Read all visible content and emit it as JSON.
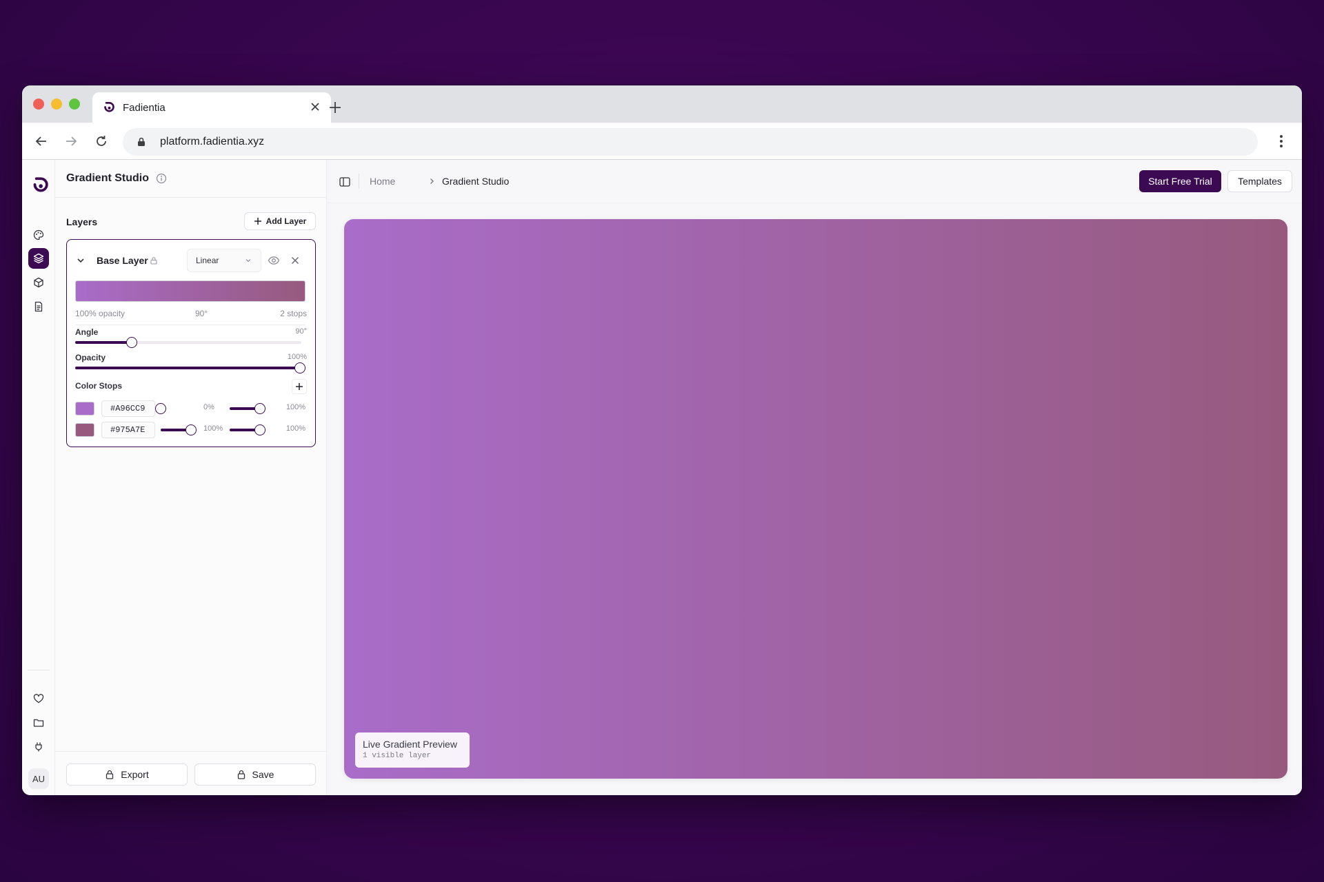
{
  "browser": {
    "tab_title": "Fadientia",
    "url": "platform.fadientia.xyz"
  },
  "app": {
    "panel_title": "Gradient Studio",
    "avatar_initials": "AU",
    "rail_icons": [
      "palette-icon",
      "layers-icon",
      "cube-icon",
      "document-icon",
      "heart-icon",
      "folder-icon",
      "plug-icon"
    ],
    "active_rail_icon": "layers-icon",
    "accent_color": "#3b0a52"
  },
  "layers": {
    "label": "Layers",
    "add_label": "Add Layer"
  },
  "layer": {
    "name": "Base Layer",
    "type": "Linear",
    "opacity_text": "100% opacity",
    "angle_text": "90°",
    "stops_text": "2 stops",
    "angle_label": "Angle",
    "angle_value": "90°",
    "angle_fraction": 0.25,
    "opacity_label": "Opacity",
    "opacity_value": "100%",
    "opacity_fraction": 1.0,
    "stops_label": "Color Stops",
    "stops": [
      {
        "color": "#A96CC9",
        "hex": "#A96CC9",
        "position": "0%",
        "position_fraction": 0.0,
        "alpha": "100%",
        "alpha_fraction": 1.0
      },
      {
        "color": "#975A7E",
        "hex": "#975A7E",
        "position": "100%",
        "position_fraction": 1.0,
        "alpha": "100%",
        "alpha_fraction": 1.0
      }
    ]
  },
  "footer": {
    "export_label": "Export",
    "save_label": "Save"
  },
  "topbar": {
    "home": "Home",
    "current": "Gradient Studio",
    "trial_label": "Start Free Trial",
    "templates_label": "Templates"
  },
  "canvas": {
    "chip_title": "Live Gradient Preview",
    "chip_sub": "1 visible layer"
  }
}
